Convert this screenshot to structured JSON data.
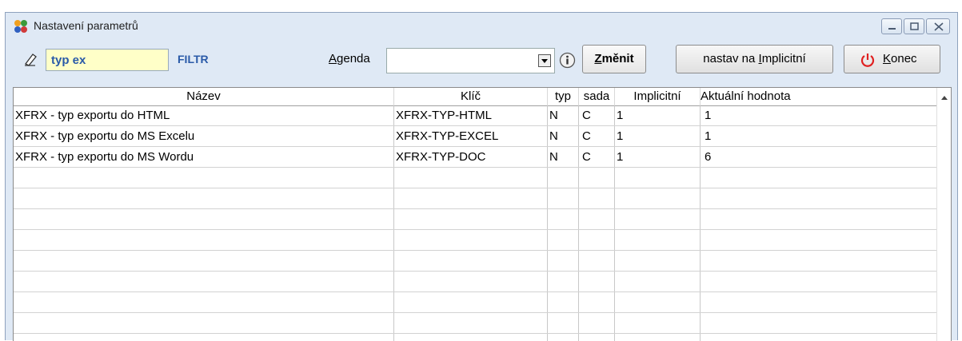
{
  "window": {
    "title": "Nastavení parametrů",
    "icon": "parameters-app-icon"
  },
  "toolbar": {
    "filter_value": "typ ex",
    "filter_label": "FILTR",
    "agenda_label": "Agenda",
    "agenda_value": "",
    "change_label": "Změnit",
    "implicit_label": "nastav na Implicitní",
    "end_label": "Konec"
  },
  "table": {
    "columns": [
      "Název",
      "Klíč",
      "typ",
      "sada",
      "Implicitní",
      "Aktuální hodnota"
    ],
    "rows": [
      {
        "nazev": "XFRX - typ exportu do HTML",
        "klic": "XFRX-TYP-HTML",
        "typ": "N",
        "sada": "C",
        "implicitni": "1",
        "aktualni": "1"
      },
      {
        "nazev": "XFRX - typ exportu do MS Excelu",
        "klic": "XFRX-TYP-EXCEL",
        "typ": "N",
        "sada": "C",
        "implicitni": "1",
        "aktualni": "1"
      },
      {
        "nazev": "XFRX - typ exportu do MS Wordu",
        "klic": "XFRX-TYP-DOC",
        "typ": "N",
        "sada": "C",
        "implicitni": "1",
        "aktualni": "6"
      }
    ]
  },
  "colors": {
    "accent_text": "#2a5aa8",
    "filter_bg": "#ffffc8",
    "power_icon": "#e02020"
  }
}
